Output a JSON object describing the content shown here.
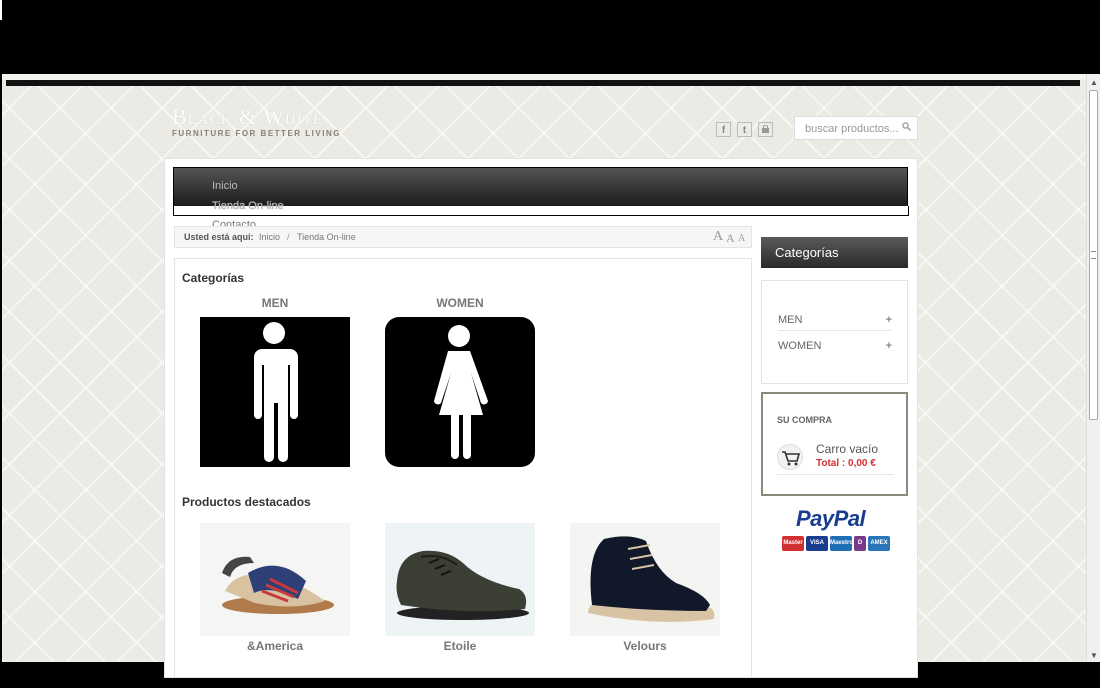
{
  "brand": {
    "name": "Black & White",
    "tagline": "FURNITURE FOR BETTER LIVING"
  },
  "search": {
    "placeholder": "buscar productos..."
  },
  "social_icons": [
    "facebook-icon",
    "twitter-icon",
    "rss-icon"
  ],
  "menu": {
    "items": [
      {
        "label": "Inicio"
      },
      {
        "label": "Tienda On-line"
      },
      {
        "label": "Contacto"
      }
    ]
  },
  "breadcrumb": {
    "prefix": "Usted está aquí:",
    "home": "Inicio",
    "separator": "/",
    "current": "Tienda On-line"
  },
  "font_size_controls": [
    "A",
    "A",
    "A"
  ],
  "main": {
    "categories_heading": "Categorías",
    "categories": [
      {
        "label": "MEN",
        "icon": "man-pictogram-icon"
      },
      {
        "label": "WOMEN",
        "icon": "woman-pictogram-icon"
      }
    ],
    "featured_heading": "Productos destacados",
    "products": [
      {
        "name": "&America"
      },
      {
        "name": "Etoile"
      },
      {
        "name": "Velours"
      }
    ]
  },
  "sidebar": {
    "categories_title": "Categorías",
    "categories": [
      {
        "label": "MEN",
        "toggle": "+"
      },
      {
        "label": "WOMEN",
        "toggle": "+"
      }
    ],
    "cart": {
      "title": "SU COMPRA",
      "status": "Carro vacío",
      "total": "Total : 0,00 €"
    },
    "payment": {
      "logo_text": "PayPal",
      "cards": [
        "Master",
        "VISA",
        "Maestro",
        "D",
        "AMEX"
      ]
    }
  },
  "colors": {
    "menu_dark": "#2a2a2a",
    "cart_total_red": "#d03030",
    "paypal_blue": "#1a3d8f"
  }
}
